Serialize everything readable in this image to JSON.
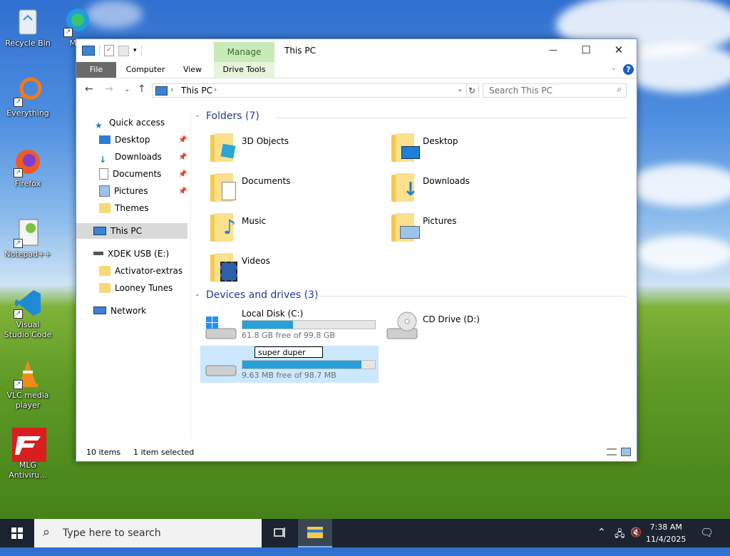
{
  "desktop": {
    "icons": [
      {
        "label": "Recycle Bin"
      },
      {
        "label": "Everything"
      },
      {
        "label": "Firefox"
      },
      {
        "label": "Notepad++"
      },
      {
        "label": "Visual Studio Code"
      },
      {
        "label": "VLC media player"
      },
      {
        "label": "MLG Antiviru..."
      },
      {
        "label": "Mi..."
      }
    ]
  },
  "window": {
    "title": "This PC",
    "manage_tab": "Manage",
    "ribbon_tabs": [
      "File",
      "Computer",
      "View",
      "Drive Tools"
    ],
    "controls": {
      "minimize": "—",
      "maximize": "☐",
      "close": "✕"
    },
    "address": {
      "path": "This PC"
    },
    "search": {
      "placeholder": "Search This PC"
    },
    "nav": {
      "quick_access": "Quick access",
      "items": [
        "Desktop",
        "Downloads",
        "Documents",
        "Pictures",
        "Themes"
      ],
      "this_pc": "This PC",
      "usb": "XDEK USB (E:)",
      "usb_items": [
        "Activator-extras",
        "Looney Tunes"
      ],
      "network": "Network"
    },
    "folders_header": "Folders (7)",
    "folders": [
      "3D Objects",
      "Desktop",
      "Documents",
      "Downloads",
      "Music",
      "Pictures",
      "Videos"
    ],
    "devices_header": "Devices and drives (3)",
    "drives": [
      {
        "name": "Local Disk (C:)",
        "free": "61.8 GB free of 99.8 GB",
        "used_fraction": 0.38
      },
      {
        "name": "CD Drive (D:)"
      },
      {
        "name": "super duper",
        "free": "9.63 MB free of 98.7 MB",
        "used_fraction": 0.9
      }
    ],
    "status": {
      "items": "10 items",
      "selected": "1 item selected"
    }
  },
  "taskbar": {
    "search_placeholder": "Type here to search",
    "time": "7:38 AM",
    "date": "11/4/2025"
  }
}
